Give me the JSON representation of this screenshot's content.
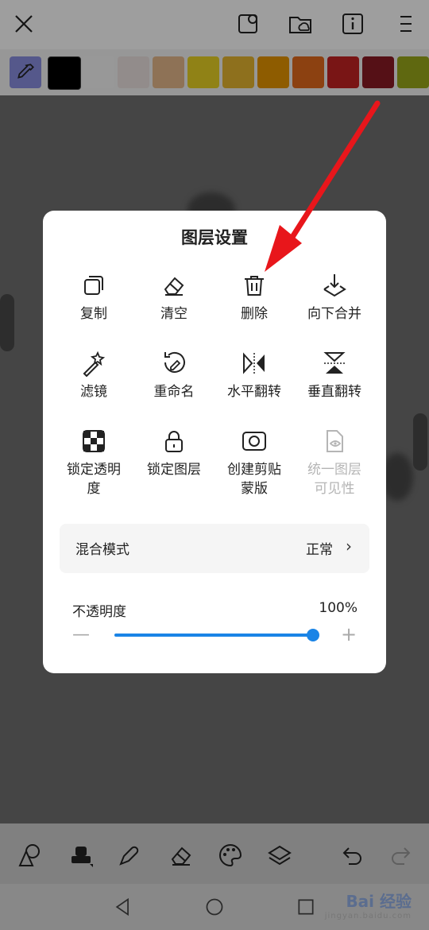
{
  "palette": {
    "colors": [
      "#000000",
      "#f5f5f5",
      "#ece3e0",
      "#e6b98c",
      "#e8d225",
      "#e6b530",
      "#e69500",
      "#e26a1c",
      "#c42222",
      "#8a1a24",
      "#9aa81a"
    ]
  },
  "dialog": {
    "title": "图层设置",
    "items": [
      {
        "label": "复制"
      },
      {
        "label": "清空"
      },
      {
        "label": "删除"
      },
      {
        "label": "向下合并"
      },
      {
        "label": "滤镜"
      },
      {
        "label": "重命名"
      },
      {
        "label": "水平翻转"
      },
      {
        "label": "垂直翻转"
      },
      {
        "label": "锁定透明\n度"
      },
      {
        "label": "锁定图层"
      },
      {
        "label": "创建剪贴\n蒙版"
      },
      {
        "label": "统一图层\n可见性"
      }
    ],
    "blend": {
      "label": "混合模式",
      "value": "正常"
    },
    "opacity": {
      "label": "不透明度",
      "value": "100%",
      "level": 1.0
    }
  },
  "watermark": {
    "main": "Bai 经验",
    "sub": "jingyan.baidu.com"
  },
  "colors": {
    "accent": "#1a84e6",
    "arrow": "#e8161b"
  }
}
